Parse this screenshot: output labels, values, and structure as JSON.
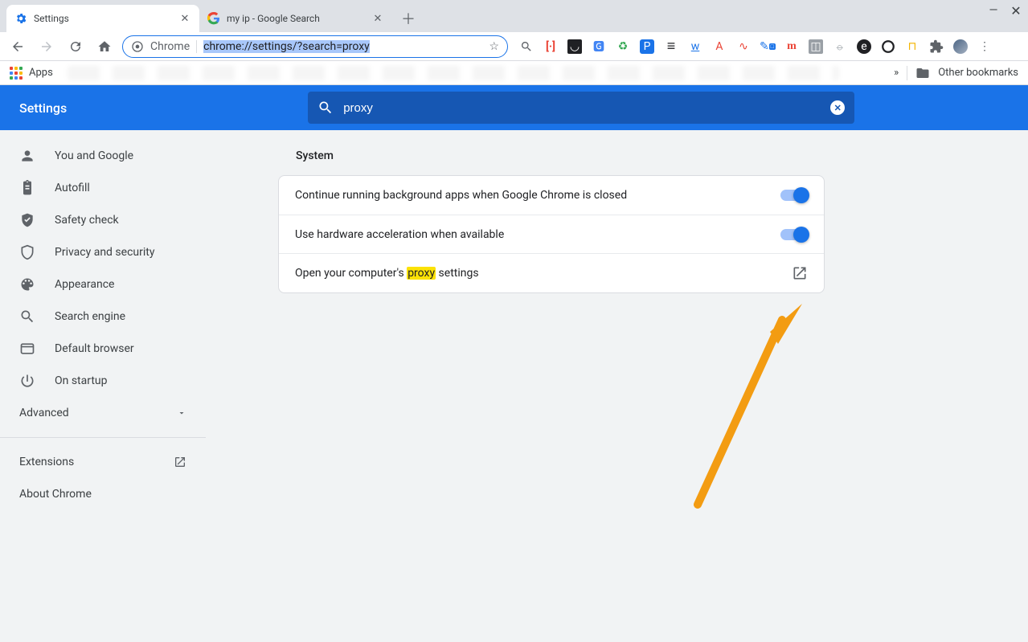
{
  "window_tabs": [
    {
      "title": "Settings",
      "active": true
    },
    {
      "title": "my ip - Google Search",
      "active": false
    }
  ],
  "omnibox": {
    "chip_label": "Chrome",
    "url_text": "chrome://settings/?search=proxy"
  },
  "bookmarks_bar": {
    "apps_label": "Apps",
    "more_label": "»",
    "other_bookmarks_label": "Other bookmarks"
  },
  "settings": {
    "header_title": "Settings",
    "search_value": "proxy",
    "sidebar": [
      {
        "label": "You and Google",
        "icon": "person"
      },
      {
        "label": "Autofill",
        "icon": "clipboard"
      },
      {
        "label": "Safety check",
        "icon": "shield-check"
      },
      {
        "label": "Privacy and security",
        "icon": "shield"
      },
      {
        "label": "Appearance",
        "icon": "palette"
      },
      {
        "label": "Search engine",
        "icon": "search"
      },
      {
        "label": "Default browser",
        "icon": "square"
      },
      {
        "label": "On startup",
        "icon": "power"
      }
    ],
    "advanced_label": "Advanced",
    "extensions_label": "Extensions",
    "about_label": "About Chrome",
    "content": {
      "section": "System",
      "rows": [
        {
          "label": "Continue running background apps when Google Chrome is closed",
          "control": "toggle-on"
        },
        {
          "label": "Use hardware acceleration when available",
          "control": "toggle-on"
        },
        {
          "prefix": "Open your computer's ",
          "highlight": "proxy",
          "suffix": " settings",
          "control": "open-external"
        }
      ]
    }
  }
}
